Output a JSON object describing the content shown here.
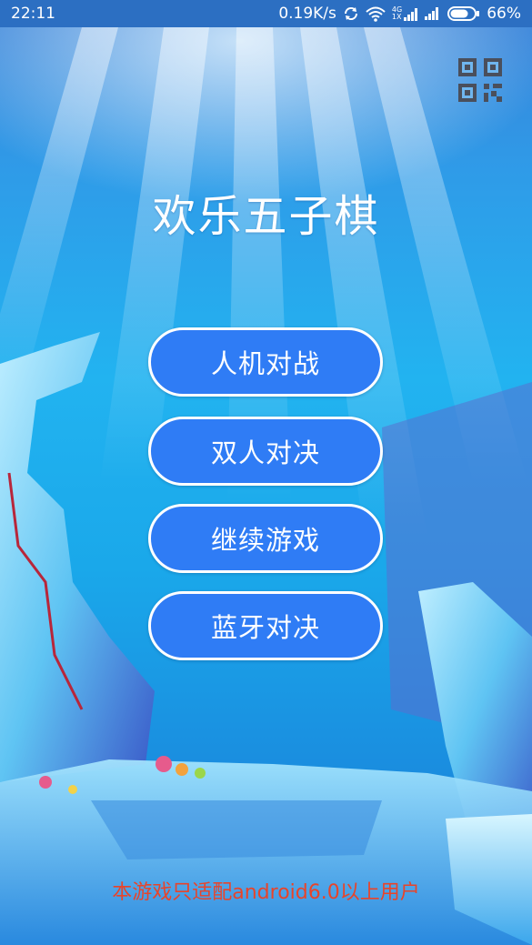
{
  "status_bar": {
    "time": "22:11",
    "net_speed": "0.19K/s",
    "network_label_top": "4G",
    "network_label_bottom": "1X",
    "battery": "66%"
  },
  "app": {
    "title": "欢乐五子棋",
    "qr_icon": "qr-code-icon"
  },
  "menu": [
    {
      "label": "人机对战"
    },
    {
      "label": "双人对决"
    },
    {
      "label": "继续游戏"
    },
    {
      "label": "蓝牙对决"
    }
  ],
  "notice": "本游戏只适配android6.0以上用户",
  "colors": {
    "button_fill": "#2f7cf5",
    "button_border": "#ffffff",
    "notice_text": "#e8442a"
  }
}
